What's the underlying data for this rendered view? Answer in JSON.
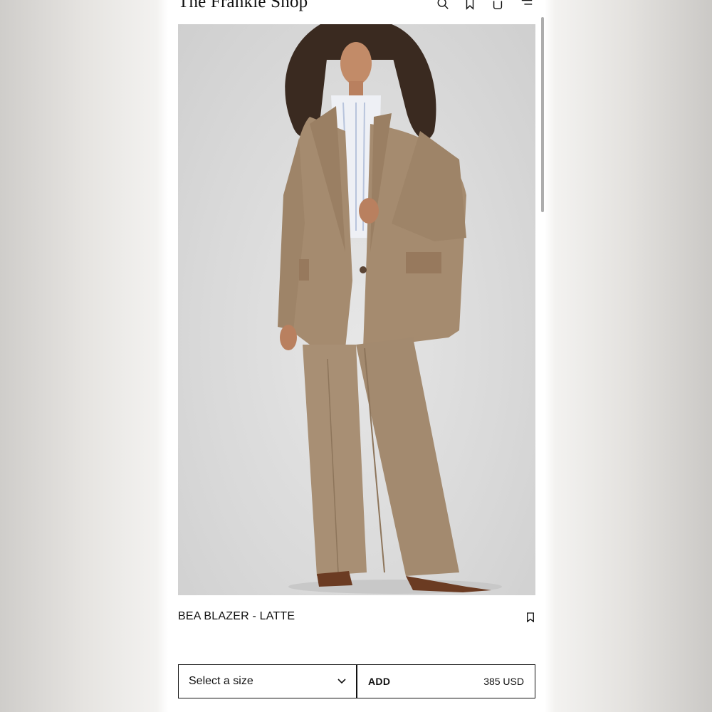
{
  "header": {
    "brand": "The Frankie Shop",
    "icons": [
      "search-icon",
      "bookmark-icon",
      "bag-icon",
      "menu-icon"
    ]
  },
  "product": {
    "title": "BEA BLAZER - LATTE",
    "image_alt": "Model wearing oversized latte blazer with matching wide-leg trousers and white striped shirt"
  },
  "purchase": {
    "size_placeholder": "Select a size",
    "add_label": "ADD",
    "price": "385 USD"
  },
  "colors": {
    "accent": "#111111",
    "garment": "#a58b6f",
    "background": "#ffffff"
  }
}
